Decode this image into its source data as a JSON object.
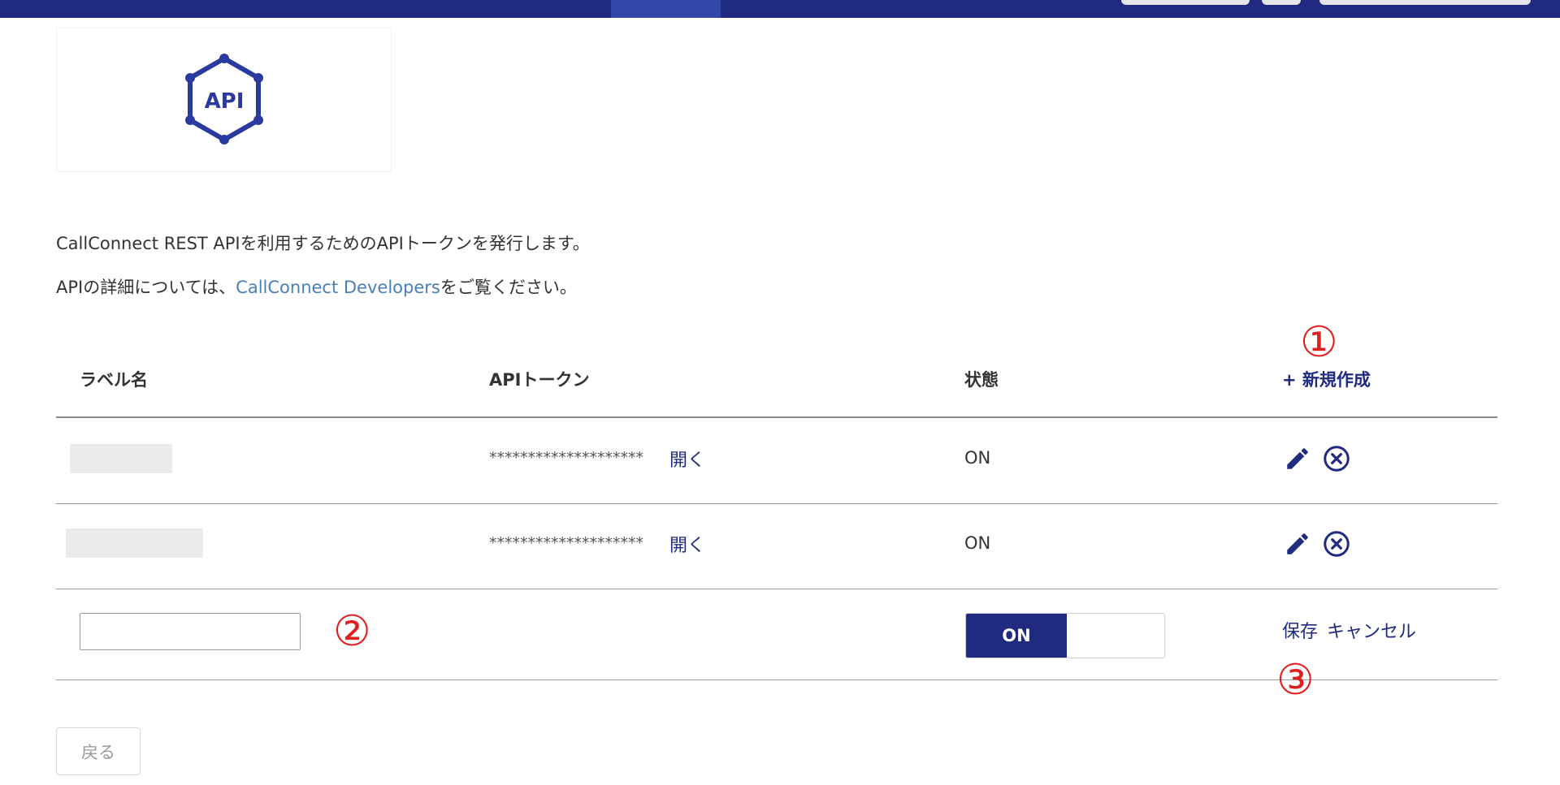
{
  "header": {
    "logo_text": "API"
  },
  "intro": {
    "line1": "CallConnect REST APIを利用するためのAPIトークンを発行します。",
    "line2_prefix": "APIの詳細については、",
    "line2_link": "CallConnect Developers",
    "line2_suffix": "をご覧ください。"
  },
  "table": {
    "columns": {
      "label": "ラベル名",
      "token": "APIトークン",
      "status": "状態"
    },
    "new_button": "+ 新規作成",
    "rows": [
      {
        "token_mask": "********************",
        "open_label": "開く",
        "status": "ON"
      },
      {
        "token_mask": "********************",
        "open_label": "開く",
        "status": "ON"
      }
    ],
    "new_row": {
      "label_value": "",
      "toggle_label": "ON",
      "save_label": "保存",
      "cancel_label": "キャンセル"
    }
  },
  "annotations": {
    "marker1": "①",
    "marker2": "②",
    "marker3": "③"
  },
  "footer": {
    "back_label": "戻る"
  },
  "colors": {
    "brand_navy": "#1f2a80",
    "link_blue": "#4a7fb5",
    "annotation_red": "#e02020"
  }
}
